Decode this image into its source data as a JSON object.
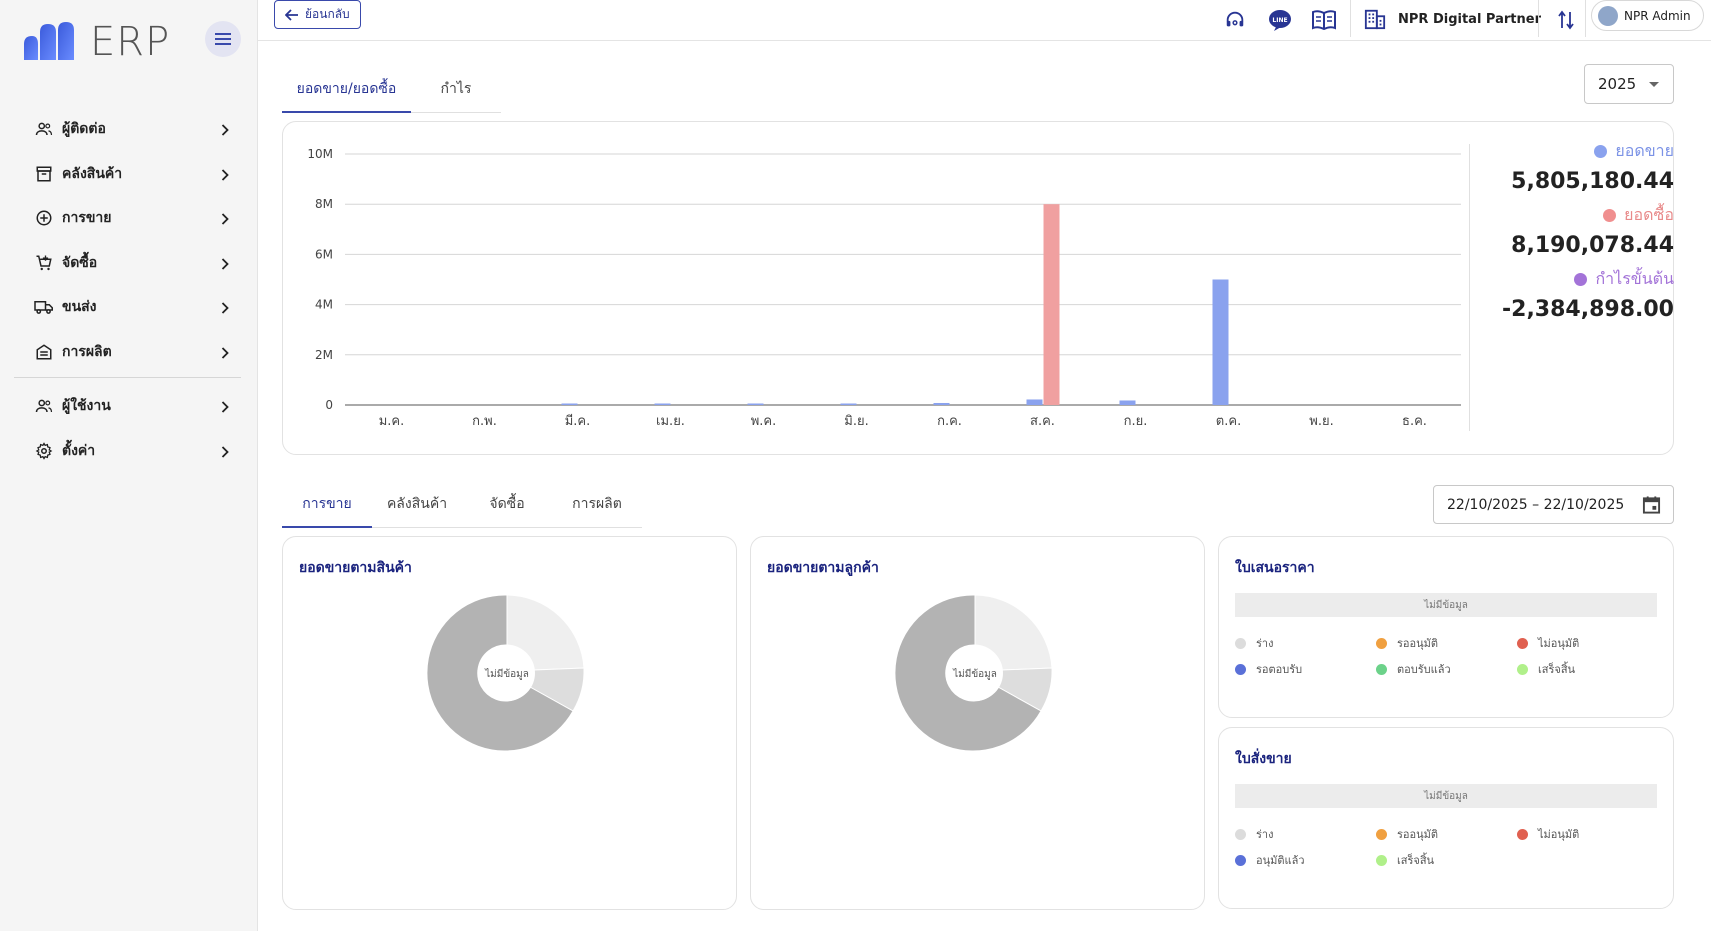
{
  "app": {
    "logo_text": "ERP"
  },
  "sidebar": {
    "items": [
      {
        "label": "ผู้ติดต่อ",
        "icon": "contacts-icon"
      },
      {
        "label": "คลังสินค้า",
        "icon": "archive-icon"
      },
      {
        "label": "การขาย",
        "icon": "add-circle-icon"
      },
      {
        "label": "จัดซื้อ",
        "icon": "cart-icon"
      },
      {
        "label": "ขนส่ง",
        "icon": "truck-icon"
      },
      {
        "label": "การผลิต",
        "icon": "factory-icon"
      }
    ],
    "bottom_items": [
      {
        "label": "ผู้ใช้งาน",
        "icon": "users-icon"
      },
      {
        "label": "ตั้งค่า",
        "icon": "gear-icon"
      }
    ]
  },
  "topbar": {
    "back_label": "ย้อนกลับ",
    "company": "NPR Digital Partner",
    "user": "NPR Admin"
  },
  "main_tabs": [
    "ยอดขาย/ยอดซื้อ",
    "กำไร"
  ],
  "year": "2025",
  "summary": {
    "sales_label": "ยอดขาย",
    "sales_value": "5,805,180.44",
    "purchase_label": "ยอดซื้อ",
    "purchase_value": "8,190,078.44",
    "profit_label": "กำไรขั้นต้น",
    "profit_value": "-2,384,898.00"
  },
  "colors": {
    "sales": "#8aa2ee",
    "purchase": "#f0a0a0",
    "profit": "#a373d8",
    "accent": "#3949ab"
  },
  "chart_data": {
    "type": "bar",
    "categories": [
      "ม.ค.",
      "ก.พ.",
      "มี.ค.",
      "เม.ย.",
      "พ.ค.",
      "มิ.ย.",
      "ก.ค.",
      "ส.ค.",
      "ก.ย.",
      "ต.ค.",
      "พ.ย.",
      "ธ.ค."
    ],
    "series": [
      {
        "name": "ยอดขาย",
        "values": [
          0,
          0,
          15000,
          20000,
          30000,
          30000,
          80000,
          220000,
          180000,
          5000000,
          0,
          0
        ]
      },
      {
        "name": "ยอดซื้อ",
        "values": [
          0,
          0,
          0,
          0,
          0,
          0,
          0,
          8000000,
          0,
          0,
          0,
          0
        ]
      }
    ],
    "y_ticks": [
      "0",
      "2M",
      "4M",
      "6M",
      "8M",
      "10M"
    ],
    "ylim": [
      0,
      10000000
    ],
    "grid": true
  },
  "section_tabs": [
    "การขาย",
    "คลังสินค้า",
    "จัดซื้อ",
    "การผลิต"
  ],
  "date_range": "22/10/2025 – 22/10/2025",
  "cards": {
    "sales_by_product": "ยอดขายตามสินค้า",
    "sales_by_customer": "ยอดขายตามลูกค้า",
    "no_data": "ไม่มีข้อมูล"
  },
  "quotation": {
    "title": "ใบเสนอราคา",
    "no_data": "ไม่มีข้อมูล",
    "legend": [
      {
        "label": "ร่าง",
        "color": "#dcdcdc"
      },
      {
        "label": "รออนุมัติ",
        "color": "#f0a040"
      },
      {
        "label": "ไม่อนุมัติ",
        "color": "#e06050"
      },
      {
        "label": "รอตอบรับ",
        "color": "#5a70d8"
      },
      {
        "label": "ตอบรับแล้ว",
        "color": "#6cd28a"
      },
      {
        "label": "เสร็จสิ้น",
        "color": "#b0f08a"
      }
    ]
  },
  "sales_order": {
    "title": "ใบสั่งขาย",
    "no_data": "ไม่มีข้อมูล",
    "legend": [
      {
        "label": "ร่าง",
        "color": "#dcdcdc"
      },
      {
        "label": "รออนุมัติ",
        "color": "#f0a040"
      },
      {
        "label": "ไม่อนุมัติ",
        "color": "#e06050"
      },
      {
        "label": "อนุมัติแล้ว",
        "color": "#5a70d8"
      },
      {
        "label": "เสร็จสิ้น",
        "color": "#b0f08a"
      }
    ]
  }
}
